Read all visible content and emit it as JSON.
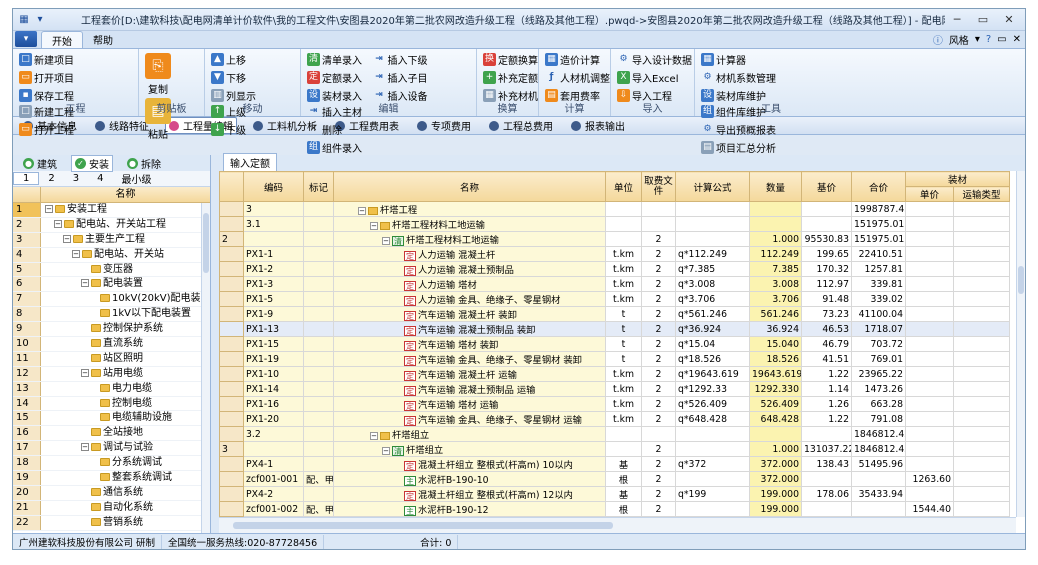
{
  "title": "工程套价[D:\\建软科技\\配电网清单计价软件\\我的工程文件\\安图县2020年第二批农网改造升级工程（线路及其他工程）.pwqd->安图县2020年第二批农网改造升级工程（线路及其他工程）] - 配电网工程造价管理软件",
  "menu": {
    "app_glyph": "▾",
    "tabs": [
      "开始",
      "帮助"
    ],
    "style_label": "风格"
  },
  "ribbon": {
    "group_project": {
      "label": "工程",
      "new_project": "新建项目",
      "open_project": "打开项目",
      "save_project": "保存工程",
      "new_engineering": "新建工程",
      "open_engineering": "打开工程"
    },
    "group_clip": {
      "label": "剪贴板",
      "copy": "复制",
      "paste": "粘贴"
    },
    "group_move": {
      "label": "移动",
      "move_up": "上移",
      "move_down": "下移",
      "up_level": "上级",
      "down_level": "下级",
      "col_show": "列显示"
    },
    "group_edit": {
      "label": "编辑",
      "list_entry": "清单录入",
      "quota_entry": "定额录入",
      "material_entry": "装材录入",
      "insert_below": "插入下级",
      "insert_child": "插入子目",
      "insert_device": "插入设备",
      "insert_main": "插入主材",
      "delete": "删除",
      "group_entry": "组件录入"
    },
    "group_convert": {
      "label": "换算",
      "quota_convert": "定额换算",
      "fill_quota": "补充定额",
      "fill_material": "补充材机"
    },
    "group_calc": {
      "label": "计算",
      "cost_calc": "造价计算",
      "labor_adjust": "人材机调整",
      "apply_rate": "套用费率"
    },
    "group_import": {
      "label": "导入",
      "import_design": "导入设计数据",
      "import_excel": "导入Excel",
      "import_project": "导入工程"
    },
    "group_tools": {
      "label": "工具",
      "calculator": "计算器",
      "material_coef": "材机系数管理",
      "material_lib": "装材库维护",
      "component_lib": "组件库维护",
      "export_budget": "导出预概报表",
      "project_summary": "项目汇总分析"
    }
  },
  "navtabs": [
    "基本信息",
    "线路特征",
    "工程量编辑",
    "工料机分析",
    "工程费用表",
    "专项费用",
    "工程总费用",
    "报表输出"
  ],
  "left": {
    "tabs": [
      "建筑",
      "安装",
      "拆除"
    ],
    "levels": [
      "1",
      "2",
      "3",
      "4",
      "最小级"
    ],
    "col_name": "名称",
    "rows": [
      "1",
      "2",
      "3",
      "4",
      "5",
      "6",
      "7",
      "8",
      "9",
      "10",
      "11",
      "12",
      "13",
      "14",
      "15",
      "16",
      "17",
      "18",
      "19",
      "20",
      "21",
      "22"
    ],
    "tree": [
      "安装工程",
      "配电站、开关站工程",
      "主要生产工程",
      "配电站、开关站",
      "变压器",
      "配电装置",
      "10kV(20kV)配电装置",
      "1kV以下配电装置",
      "控制保护系统",
      "直流系统",
      "站区照明",
      "站用电缆",
      "电力电缆",
      "控制电缆",
      "电缆辅助设施",
      "全站接地",
      "调试与试验",
      "分系统调试",
      "整套系统调试",
      "通信系统",
      "自动化系统",
      "营销系统"
    ]
  },
  "right_tab": "输入定额",
  "grid": {
    "headers": {
      "code": "编码",
      "mark": "标记",
      "name": "名称",
      "unit": "单位",
      "fee_file": "取费文件",
      "formula": "计算公式",
      "qty": "数量",
      "base": "基价",
      "total": "合价",
      "install_mat": "装材",
      "unit_price": "单价",
      "transport": "运输类型"
    },
    "rows": [
      {
        "rn": "",
        "code": "3",
        "mark": "",
        "name": "杆塔工程",
        "unit": "",
        "fee": "",
        "formula": "",
        "qty": "",
        "base": "",
        "total": "1998787.43",
        "up": "",
        "tr": ""
      },
      {
        "rn": "",
        "code": "3.1",
        "mark": "",
        "name": "杆塔工程材料工地运输",
        "unit": "",
        "fee": "",
        "formula": "",
        "qty": "",
        "base": "",
        "total": "151975.01",
        "up": "",
        "tr": ""
      },
      {
        "rn": "2",
        "code": "",
        "mark": "",
        "name": "杆塔工程材料工地运输",
        "unit": "",
        "fee": "2",
        "formula": "",
        "qty": "1.000",
        "base": "95530.83",
        "total": "151975.01",
        "up": "",
        "tr": ""
      },
      {
        "rn": "",
        "code": "PX1-1",
        "mark": "",
        "name": "人力运输 混凝土杆",
        "unit": "t.km",
        "fee": "2",
        "formula": "q*112.249",
        "qty": "112.249",
        "base": "199.65",
        "total": "22410.51",
        "up": "",
        "tr": ""
      },
      {
        "rn": "",
        "code": "PX1-2",
        "mark": "",
        "name": "人力运输 混凝土预制品",
        "unit": "t.km",
        "fee": "2",
        "formula": "q*7.385",
        "qty": "7.385",
        "base": "170.32",
        "total": "1257.81",
        "up": "",
        "tr": ""
      },
      {
        "rn": "",
        "code": "PX1-3",
        "mark": "",
        "name": "人力运输 塔材",
        "unit": "t.km",
        "fee": "2",
        "formula": "q*3.008",
        "qty": "3.008",
        "base": "112.97",
        "total": "339.81",
        "up": "",
        "tr": ""
      },
      {
        "rn": "",
        "code": "PX1-5",
        "mark": "",
        "name": "人力运输 金具、绝缘子、零星钢材",
        "unit": "t.km",
        "fee": "2",
        "formula": "q*3.706",
        "qty": "3.706",
        "base": "91.48",
        "total": "339.02",
        "up": "",
        "tr": ""
      },
      {
        "rn": "",
        "code": "PX1-9",
        "mark": "",
        "name": "汽车运输 混凝土杆 装卸",
        "unit": "t",
        "fee": "2",
        "formula": "q*561.246",
        "qty": "561.246",
        "base": "73.23",
        "total": "41100.04",
        "up": "",
        "tr": ""
      },
      {
        "rn": "",
        "code": "PX1-13",
        "mark": "",
        "name": "汽车运输 混凝土预制品 装卸",
        "unit": "t",
        "fee": "2",
        "formula": "q*36.924",
        "qty": "36.924",
        "base": "46.53",
        "total": "1718.07",
        "up": "",
        "tr": ""
      },
      {
        "rn": "",
        "code": "PX1-15",
        "mark": "",
        "name": "汽车运输 塔材 装卸",
        "unit": "t",
        "fee": "2",
        "formula": "q*15.04",
        "qty": "15.040",
        "base": "46.79",
        "total": "703.72",
        "up": "",
        "tr": ""
      },
      {
        "rn": "",
        "code": "PX1-19",
        "mark": "",
        "name": "汽车运输 金具、绝缘子、零星钢材 装卸",
        "unit": "t",
        "fee": "2",
        "formula": "q*18.526",
        "qty": "18.526",
        "base": "41.51",
        "total": "769.01",
        "up": "",
        "tr": ""
      },
      {
        "rn": "",
        "code": "PX1-10",
        "mark": "",
        "name": "汽车运输 混凝土杆 运输",
        "unit": "t.km",
        "fee": "2",
        "formula": "q*19643.619",
        "qty": "19643.619",
        "base": "1.22",
        "total": "23965.22",
        "up": "",
        "tr": ""
      },
      {
        "rn": "",
        "code": "PX1-14",
        "mark": "",
        "name": "汽车运输 混凝土预制品 运输",
        "unit": "t.km",
        "fee": "2",
        "formula": "q*1292.33",
        "qty": "1292.330",
        "base": "1.14",
        "total": "1473.26",
        "up": "",
        "tr": ""
      },
      {
        "rn": "",
        "code": "PX1-16",
        "mark": "",
        "name": "汽车运输 塔材 运输",
        "unit": "t.km",
        "fee": "2",
        "formula": "q*526.409",
        "qty": "526.409",
        "base": "1.26",
        "total": "663.28",
        "up": "",
        "tr": ""
      },
      {
        "rn": "",
        "code": "PX1-20",
        "mark": "",
        "name": "汽车运输 金具、绝缘子、零星钢材 运输",
        "unit": "t.km",
        "fee": "2",
        "formula": "q*648.428",
        "qty": "648.428",
        "base": "1.22",
        "total": "791.08",
        "up": "",
        "tr": ""
      },
      {
        "rn": "",
        "code": "3.2",
        "mark": "",
        "name": "杆塔组立",
        "unit": "",
        "fee": "",
        "formula": "",
        "qty": "",
        "base": "",
        "total": "1846812.42",
        "up": "",
        "tr": ""
      },
      {
        "rn": "3",
        "code": "",
        "mark": "",
        "name": "杆塔组立",
        "unit": "",
        "fee": "2",
        "formula": "",
        "qty": "1.000",
        "base": "131037.22",
        "total": "1846812.42",
        "up": "",
        "tr": ""
      },
      {
        "rn": "",
        "code": "PX4-1",
        "mark": "",
        "name": "混凝土杆组立 整根式(杆高m) 10以内",
        "unit": "基",
        "fee": "2",
        "formula": "q*372",
        "qty": "372.000",
        "base": "138.43",
        "total": "51495.96",
        "up": "",
        "tr": ""
      },
      {
        "rn": "",
        "code": "zcf001-001",
        "mark": "配、甲",
        "name": "水泥杆B-190-10",
        "unit": "根",
        "fee": "2",
        "formula": "",
        "qty": "372.000",
        "base": "",
        "total": "",
        "up": "1263.60",
        "tr": ""
      },
      {
        "rn": "",
        "code": "PX4-2",
        "mark": "",
        "name": "混凝土杆组立 整根式(杆高m) 12以内",
        "unit": "基",
        "fee": "2",
        "formula": "q*199",
        "qty": "199.000",
        "base": "178.06",
        "total": "35433.94",
        "up": "",
        "tr": ""
      },
      {
        "rn": "",
        "code": "zcf001-002",
        "mark": "配、甲",
        "name": "水泥杆B-190-12",
        "unit": "根",
        "fee": "2",
        "formula": "",
        "qty": "199.000",
        "base": "",
        "total": "",
        "up": "1544.40",
        "tr": ""
      }
    ]
  },
  "status": {
    "company": "广州建软科技股份有限公司 研制",
    "hotline": "全国统一服务热线:020-87728456",
    "total_label": "合计: 0"
  }
}
